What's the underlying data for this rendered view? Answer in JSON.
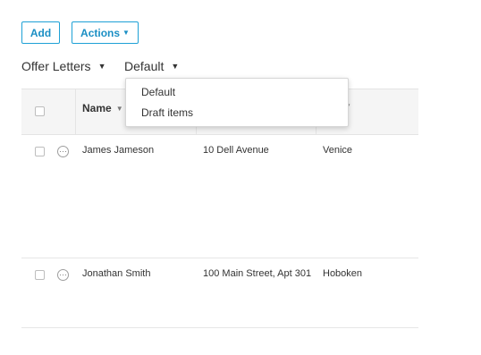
{
  "toolbar": {
    "add_label": "Add",
    "actions_label": "Actions"
  },
  "filters": {
    "list_label": "Offer Letters",
    "view_label": "Default"
  },
  "table": {
    "columns": [
      {
        "label": "Name",
        "sortable": true
      },
      {
        "label": "",
        "sortable": false
      },
      {
        "label": "",
        "sortable": true
      }
    ],
    "rows": [
      {
        "name": "James Jameson",
        "address": "10 Dell Avenue",
        "city": "Venice",
        "selected": false
      },
      {
        "name": "Jonathan Smith",
        "address": "100 Main Street, Apt 301",
        "city": "Hoboken",
        "selected": false
      }
    ]
  },
  "view_dropdown": {
    "open": true,
    "options": [
      "Default",
      "Draft items"
    ]
  },
  "icons": {
    "caret": "caret-down-icon",
    "row_menu": "more-horizontal-icon",
    "checkbox": "checkbox-icon"
  },
  "colors": {
    "accent": "#1ea1d6",
    "header_bg": "#f5f5f5",
    "border": "#e4e4e4"
  }
}
